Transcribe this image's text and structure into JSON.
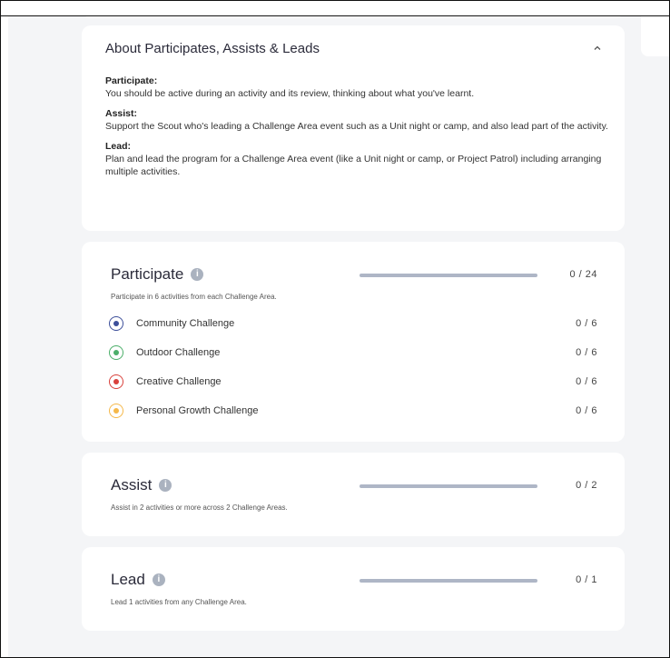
{
  "about": {
    "title": "About Participates, Assists & Leads",
    "items": [
      {
        "term": "Participate:",
        "text": "You should be active during an activity and its review, thinking about what you've learnt."
      },
      {
        "term": "Assist:",
        "text": "Support the Scout who's leading a Challenge Area event such as a Unit night or camp, and also lead part of the activity."
      },
      {
        "term": "Lead:",
        "text": "Plan and lead the program for a Challenge Area event (like a Unit night or camp, or Project Patrol) including arranging multiple activities."
      }
    ]
  },
  "participate": {
    "title": "Participate",
    "subtitle": "Participate in 6 activities from each Challenge Area.",
    "count": "0 / 24",
    "progress": 0,
    "areas": [
      {
        "label": "Community Challenge",
        "value": "0 / 6",
        "color": "#3d4f9a",
        "icon": "community-icon"
      },
      {
        "label": "Outdoor Challenge",
        "value": "0 / 6",
        "color": "#4caf6a",
        "icon": "outdoor-icon"
      },
      {
        "label": "Creative Challenge",
        "value": "0 / 6",
        "color": "#d9413c",
        "icon": "creative-icon"
      },
      {
        "label": "Personal Growth Challenge",
        "value": "0 / 6",
        "color": "#f5b84a",
        "icon": "personal-growth-icon"
      }
    ]
  },
  "assist": {
    "title": "Assist",
    "subtitle": "Assist in 2 activities or more across 2 Challenge Areas.",
    "count": "0 / 2",
    "progress": 0
  },
  "lead": {
    "title": "Lead",
    "subtitle": "Lead 1 activities from any Challenge Area.",
    "count": "0 / 1",
    "progress": 0
  },
  "colors": {
    "background": "#f4f5f7",
    "card": "#ffffff",
    "bar_track": "#aeb6c6",
    "info_icon": "#aab2bf"
  }
}
